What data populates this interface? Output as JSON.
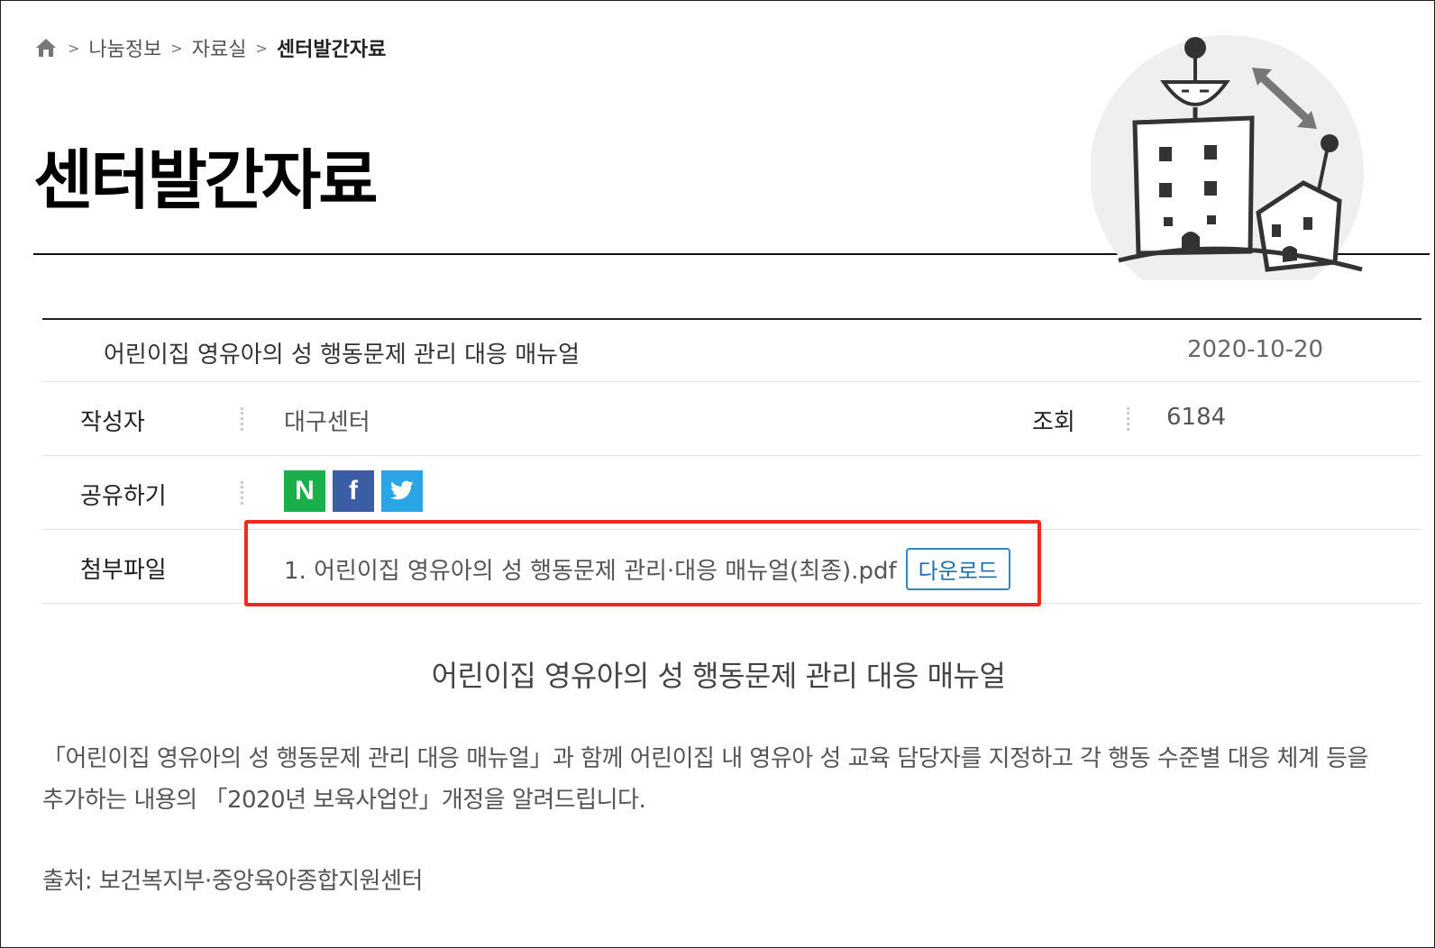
{
  "breadcrumb": {
    "items": [
      "나눔정보",
      "자료실"
    ],
    "current": "센터발간자료",
    "separator": ">"
  },
  "page": {
    "title": "센터발간자료"
  },
  "post": {
    "title": "어린이집 영유아의 성 행동문제 관리 대응 매뉴얼",
    "date": "2020-10-20",
    "author_label": "작성자",
    "author": "대구센터",
    "views_label": "조회",
    "views": "6184",
    "share_label": "공유하기",
    "share_buttons": [
      {
        "name": "naver",
        "glyph": "N"
      },
      {
        "name": "facebook",
        "glyph": "f"
      },
      {
        "name": "twitter",
        "glyph": "twitter-bird"
      }
    ],
    "attachment_label": "첨부파일",
    "attachment_file": "1. 어린이집 영유아의 성 행동문제 관리·대응 매뉴얼(최종).pdf",
    "download_label": "다운로드"
  },
  "content": {
    "heading": "어린이집 영유아의 성 행동문제 관리 대응 매뉴얼",
    "body": "「어린이집 영유아의 성 행동문제 관리 대응 매뉴얼」과 함께 어린이집 내 영유아 성 교육 담당자를 지정하고 각 행동 수준별 대응 체계 등을 추가하는 내용의 「2020년 보육사업안」개정을 알려드립니다.",
    "source": "출처: 보건복지부·중앙육아종합지원센터"
  },
  "colors": {
    "highlight": "#f02b1e",
    "naver": "#19b04b",
    "facebook": "#3b5da3",
    "twitter": "#2aa6e6",
    "download_border": "#2f87c8"
  }
}
